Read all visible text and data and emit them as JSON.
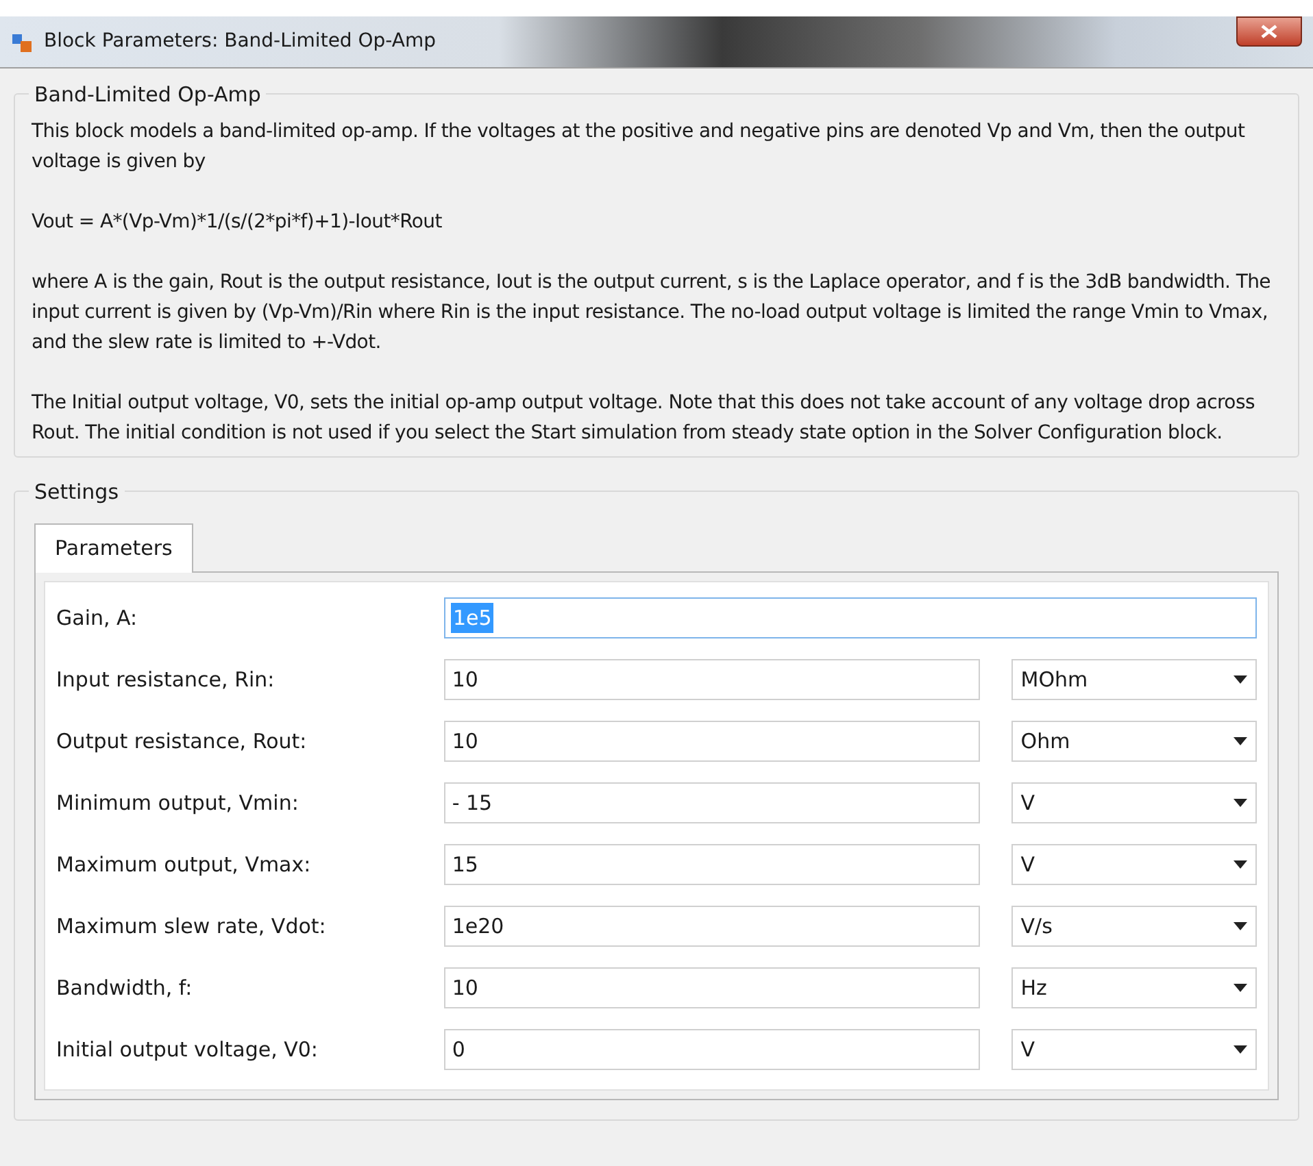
{
  "window": {
    "title": "Block Parameters: Band-Limited Op-Amp"
  },
  "description": {
    "title": "Band-Limited Op-Amp",
    "paragraphs": [
      "This block models a band-limited op-amp. If the voltages at the positive and negative pins are denoted Vp and Vm, then the output voltage is given by",
      "Vout = A*(Vp-Vm)*1/(s/(2*pi*f)+1)-Iout*Rout",
      "where A is the gain, Rout is the output resistance, Iout is the output current, s is the Laplace operator, and f is the 3dB bandwidth. The input current is given by (Vp-Vm)/Rin where Rin is the input resistance. The no-load output voltage is limited the range Vmin to Vmax, and the slew rate is limited to +-Vdot.",
      "The Initial output voltage, V0, sets the initial op-amp output voltage. Note that this does not take account of any voltage drop across Rout. The initial condition is not used if you select the Start simulation from steady state option in the Solver Configuration block."
    ]
  },
  "settings": {
    "title": "Settings",
    "tabs": [
      {
        "label": "Parameters",
        "selected": true
      }
    ],
    "parameters": [
      {
        "label": "Gain, A:",
        "value": "1e5",
        "highlighted": true
      },
      {
        "label": "Input resistance, Rin:",
        "value": "10",
        "unit": "MOhm",
        "highlighted": false
      },
      {
        "label": "Output resistance, Rout:",
        "value": "10",
        "unit": "Ohm",
        "highlighted": false
      },
      {
        "label": "Minimum output, Vmin:",
        "value": "- 15",
        "unit": "V",
        "highlighted": false
      },
      {
        "label": "Maximum output, Vmax:",
        "value": "15",
        "unit": "V",
        "highlighted": false
      },
      {
        "label": "Maximum slew rate, Vdot:",
        "value": "1e20",
        "unit": "V/s",
        "highlighted": false
      },
      {
        "label": "Bandwidth, f:",
        "value": "10",
        "unit": "Hz",
        "highlighted": false
      },
      {
        "label": "Initial output voltage, V0:",
        "value": "0",
        "unit": "V",
        "highlighted": false
      }
    ]
  }
}
